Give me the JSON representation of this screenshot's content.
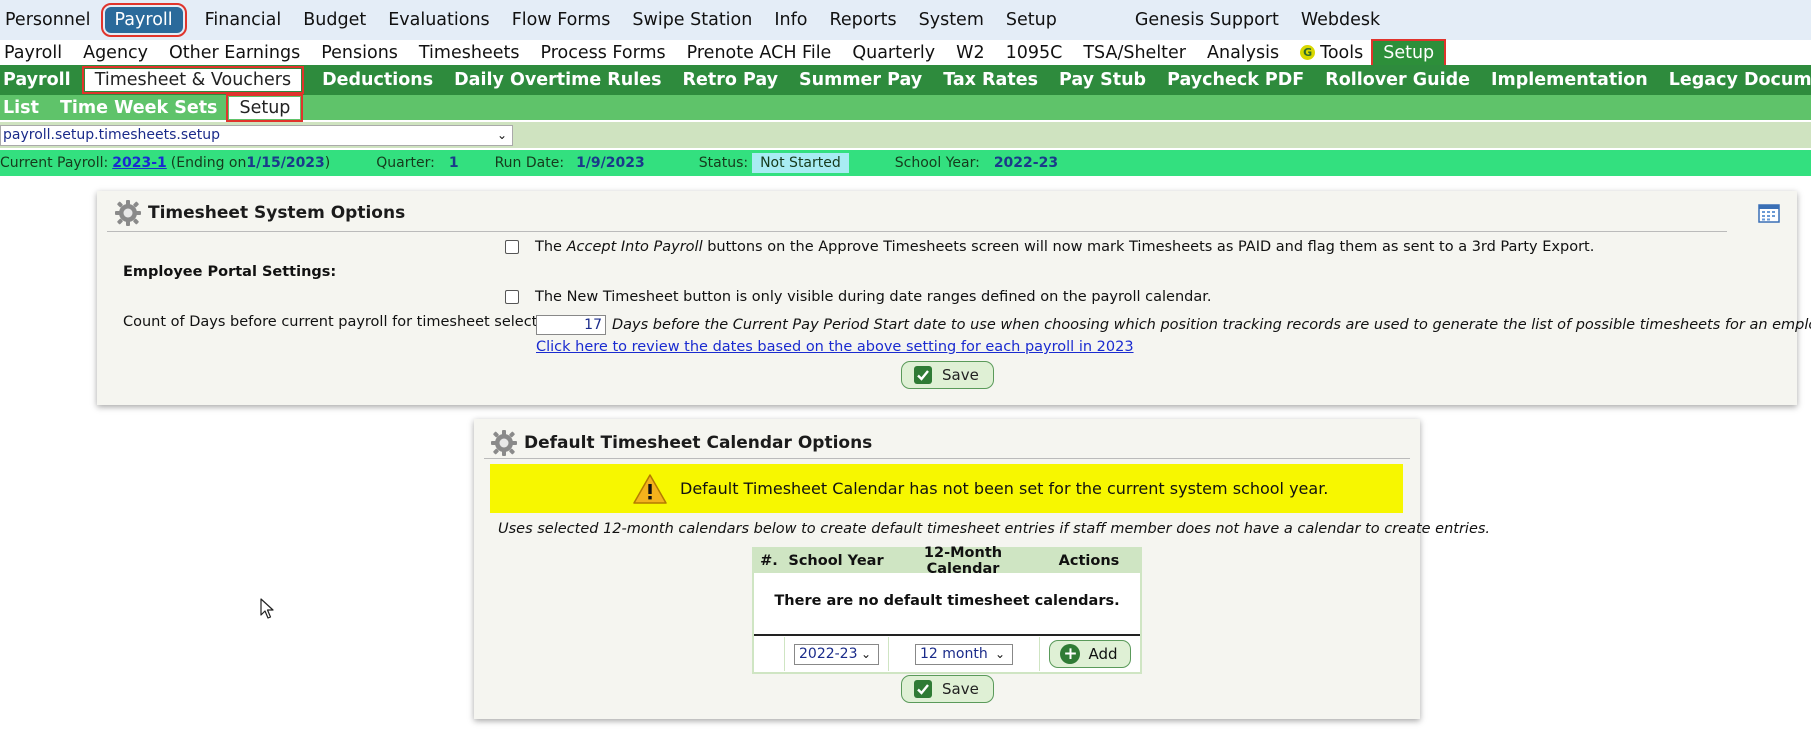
{
  "nav_main": [
    "Personnel",
    "Payroll",
    "Financial",
    "Budget",
    "Evaluations",
    "Flow Forms",
    "Swipe Station",
    "Info",
    "Reports",
    "System",
    "Setup"
  ],
  "nav_main_extra": [
    "Genesis Support",
    "Webdesk"
  ],
  "nav_payroll": [
    "Payroll",
    "Agency",
    "Other Earnings",
    "Pensions",
    "Timesheets",
    "Process Forms",
    "Prenote ACH File",
    "Quarterly",
    "W2",
    "1095C",
    "TSA/Shelter",
    "Analysis",
    "Tools",
    "Setup"
  ],
  "nav_setup": [
    "Payroll",
    "Timesheet & Vouchers",
    "Deductions",
    "Daily Overtime Rules",
    "Retro Pay",
    "Summer Pay",
    "Tax Rates",
    "Pay Stub",
    "Paycheck PDF",
    "Rollover Guide",
    "Implementation",
    "Legacy Documents"
  ],
  "nav_timesheet": [
    "List",
    "Time Week Sets",
    "Setup"
  ],
  "path_value": "payroll.setup.timesheets.setup",
  "status": {
    "current_payroll_label": "Current Payroll:",
    "current_payroll_link": "2023-1",
    "ending_prefix": "(Ending on ",
    "ending_date": "1/15/2023",
    "ending_suffix": ")",
    "quarter_label": "Quarter:",
    "quarter_value": "1",
    "run_date_label": "Run Date:",
    "run_date_value": "1/9/2023",
    "status_label": "Status:",
    "status_value": "Not Started",
    "school_year_label": "School Year:",
    "school_year_value": "2022-23"
  },
  "system_options": {
    "title": "Timesheet System Options",
    "accept_pre": "The ",
    "accept_em": "Accept Into Payroll",
    "accept_post": " buttons on the Approve Timesheets screen will now mark Timesheets as PAID and flag them as sent to a 3rd Party Export.",
    "portal_heading": "Employee Portal Settings:",
    "new_timesheet_text": "The New Timesheet button is only visible during date ranges defined on the payroll calendar.",
    "count_label": "Count of Days before current payroll for timesheet selection:",
    "count_value": "17",
    "count_desc": "Days before the Current Pay Period Start date to use when choosing which position tracking records are used to generate the list of possible timesheets for an employee to fill.",
    "review_link": "Click here to review the dates based on the above setting for each payroll in 2023",
    "save_label": "Save"
  },
  "calendar_options": {
    "title": "Default Timesheet Calendar Options",
    "warning": "Default Timesheet Calendar has not been set for the current system school year.",
    "note": "Uses selected 12-month calendars below to create default timesheet entries if staff member does not have a calendar to create entries.",
    "columns": [
      "#.",
      "School Year",
      "12-Month Calendar",
      "Actions"
    ],
    "empty_message": "There are no default timesheet calendars.",
    "school_year_select": "2022-23",
    "calendar_select": "12 month",
    "add_label": "Add",
    "save_label": "Save"
  },
  "colors": {
    "nav_active_blue": "#2a6a9b",
    "nav_green_dark": "#2e8b3d",
    "nav_green_light": "#5fc36a",
    "status_green": "#33e07f",
    "highlight_red": "#e0342c",
    "warning_yellow": "#f7f700"
  }
}
